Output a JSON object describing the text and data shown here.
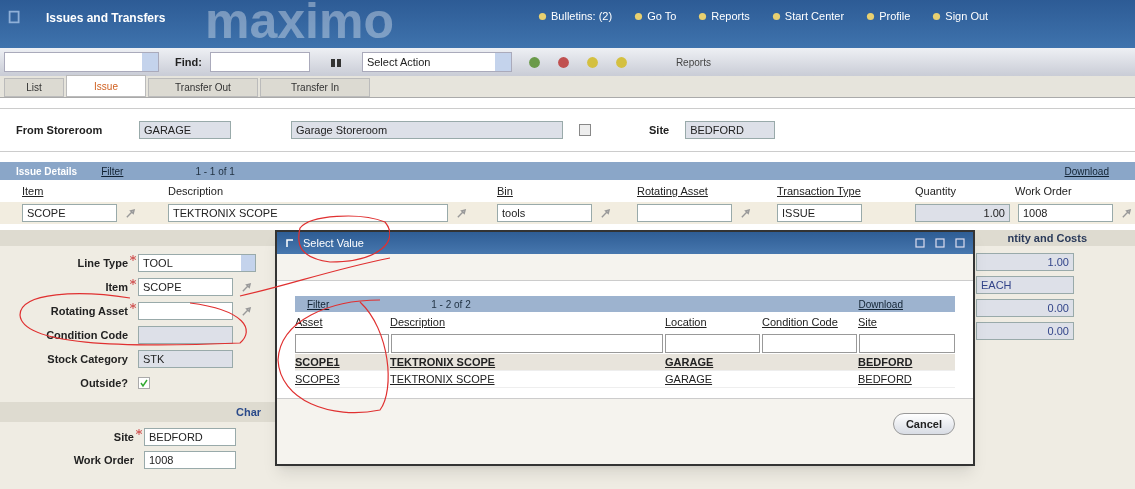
{
  "header": {
    "logo": "maximo",
    "title": "Issues and Transfers",
    "links": [
      {
        "label": "Bulletins: (2)"
      },
      {
        "label": "Go To"
      },
      {
        "label": "Reports"
      },
      {
        "label": "Start Center"
      },
      {
        "label": "Profile"
      },
      {
        "label": "Sign Out"
      }
    ]
  },
  "toolbar": {
    "find_label": "Find:",
    "action_select": "Select Action",
    "reports": "Reports"
  },
  "tabs": [
    {
      "label": "List",
      "selected": false
    },
    {
      "label": "Issue",
      "selected": true
    },
    {
      "label": "Transfer Out",
      "selected": false
    },
    {
      "label": "Transfer In",
      "selected": false
    }
  ],
  "storeroom": {
    "label": "From Storeroom",
    "code": "GARAGE",
    "description": "Garage Storeroom",
    "checked": false,
    "site_label": "Site",
    "site": "BEDFORD"
  },
  "issue_table": {
    "title": "Issue Details",
    "filter": "Filter",
    "paging": "1 - 1 of 1",
    "download": "Download",
    "columns": [
      "Item",
      "Description",
      "Bin",
      "Rotating Asset",
      "Transaction Type",
      "Quantity",
      "Work Order"
    ],
    "rows": [
      {
        "cells": [
          "SCOPE",
          "TEKTRONIX SCOPE",
          "tools",
          "",
          "ISSUE",
          "1.00",
          "1008"
        ]
      }
    ]
  },
  "details": {
    "fields": [
      {
        "label": "Line Type",
        "required": true,
        "value": "TOOL",
        "kind": "select"
      },
      {
        "label": "Item",
        "required": true,
        "value": "SCOPE",
        "kind": "lookup"
      },
      {
        "label": "Rotating Asset",
        "required": true,
        "kind": "lookup"
      },
      {
        "label": "Condition Code",
        "required": false,
        "kind": "readonly"
      },
      {
        "label": "Stock Category",
        "required": false,
        "value": "STK",
        "kind": "readonly"
      },
      {
        "label": "Outside?",
        "required": false,
        "checked": true,
        "kind": "checkbox"
      }
    ],
    "charge_section": "Char",
    "charge_fields": [
      {
        "label": "Site",
        "required": true,
        "value": "BEDFORD"
      },
      {
        "label": "Work Order",
        "required": false,
        "value": "1008"
      }
    ],
    "quantity_section": "ntity and Costs",
    "quantity_values": [
      "1.00",
      "EACH",
      "0.00",
      "0.00"
    ]
  },
  "dialog": {
    "title": "Select Value",
    "filter": "Filter",
    "paging": "1 - 2 of 2",
    "download": "Download",
    "columns": [
      "Asset",
      "Description",
      "Location",
      "Condition Code",
      "Site"
    ],
    "rows": [
      {
        "selected": true,
        "cells": [
          "SCOPE1",
          "TEKTRONIX SCOPE",
          "GARAGE",
          "",
          "BEDFORD"
        ]
      },
      {
        "selected": false,
        "cells": [
          "SCOPE3",
          "TEKTRONIX SCOPE",
          "GARAGE",
          "",
          "BEDFORD"
        ]
      }
    ],
    "cancel": "Cancel"
  }
}
